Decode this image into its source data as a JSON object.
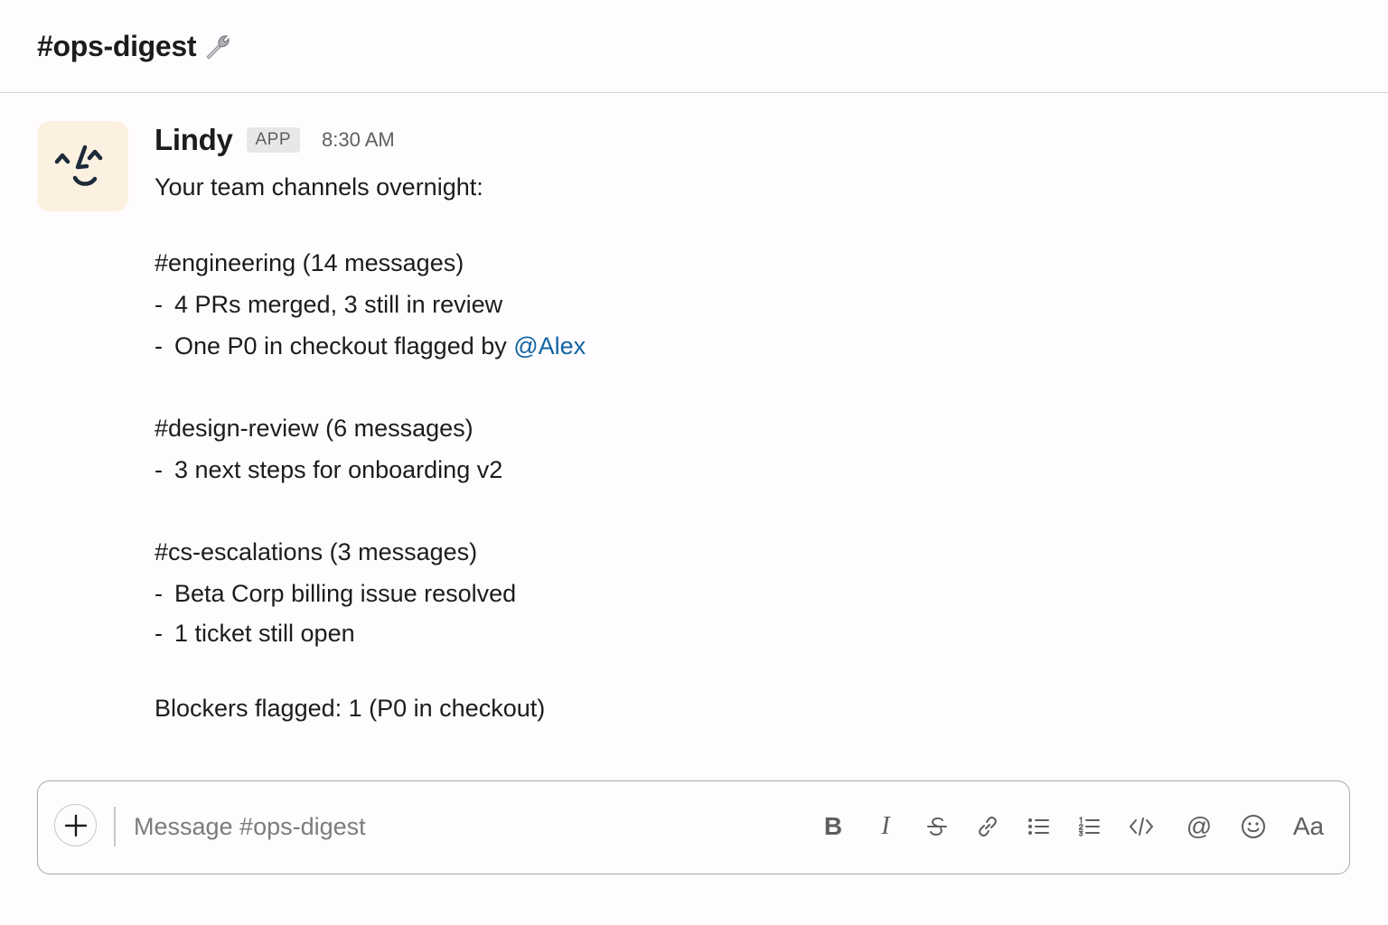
{
  "header": {
    "channel_title": "#ops-digest"
  },
  "message": {
    "sender": "Lindy",
    "badge": "APP",
    "timestamp": "8:30 AM",
    "intro": "Your team channels overnight:",
    "sections": [
      {
        "heading": "#engineering (14 messages)",
        "bullets": [
          {
            "dash": "-",
            "text": "4 PRs merged, 3 still in review"
          },
          {
            "dash": "-",
            "text": "One P0 in checkout flagged by ",
            "mention": "@Alex"
          }
        ]
      },
      {
        "heading": "#design-review (6 messages)",
        "bullets": [
          {
            "dash": "-",
            "text": "3 next steps for onboarding v2"
          }
        ]
      },
      {
        "heading": "#cs-escalations (3 messages)",
        "bullets": [
          {
            "dash": "-",
            "text": "Beta Corp billing issue resolved"
          },
          {
            "dash": "-",
            "text": "1 ticket still open"
          }
        ]
      }
    ],
    "footer": "Blockers flagged: 1 (P0 in checkout)"
  },
  "composer": {
    "placeholder": "Message #ops-digest",
    "format_buttons": [
      {
        "icon": "bold-icon",
        "label": "B"
      },
      {
        "icon": "italic-icon",
        "label": "I"
      },
      {
        "icon": "strikethrough-icon"
      },
      {
        "icon": "link-icon"
      },
      {
        "icon": "bulleted-list-icon"
      },
      {
        "icon": "numbered-list-icon"
      },
      {
        "icon": "code-icon"
      },
      {
        "icon": "mention-icon",
        "label": "@"
      },
      {
        "icon": "emoji-icon"
      },
      {
        "icon": "text-format-icon",
        "label": "Aa"
      }
    ]
  },
  "colors": {
    "mention": "#1264a3",
    "avatar_bg": "#fcf1e1",
    "badge_bg": "#e8e7e8"
  }
}
